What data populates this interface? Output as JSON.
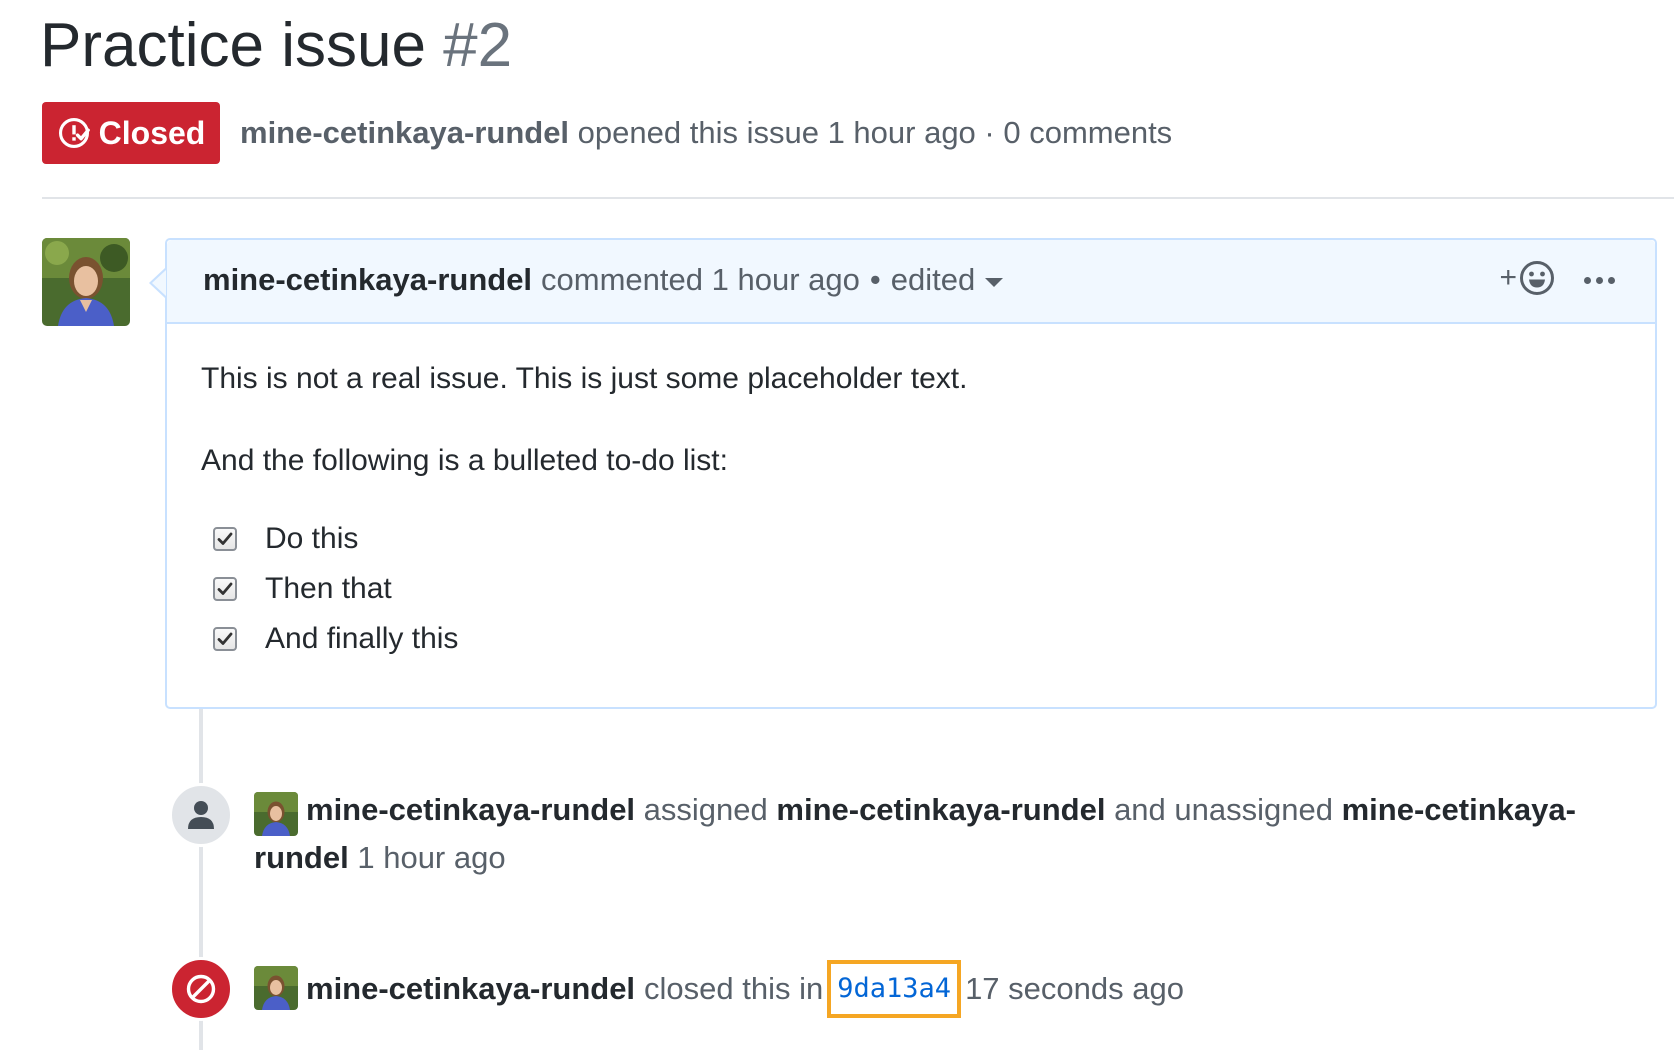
{
  "issue": {
    "title": "Practice issue",
    "number": "#2",
    "state": "Closed",
    "author": "mine-cetinkaya-rundel",
    "meta_rest": "opened this issue 1 hour ago · 0 comments",
    "state_color": "#cb2431"
  },
  "comment": {
    "author": "mine-cetinkaya-rundel",
    "action": "commented 1 hour ago",
    "edited": "edited",
    "separator": "•",
    "reaction_plus": "+",
    "body_paragraph_1": "This is not a real issue. This is just some placeholder text.",
    "body_paragraph_2": "And the following is a bulleted to-do list:",
    "tasks": [
      {
        "label": "Do this",
        "checked": true
      },
      {
        "label": "Then that",
        "checked": true
      },
      {
        "label": "And finally this",
        "checked": true
      }
    ]
  },
  "timeline": {
    "assign_event": {
      "actor": "mine-cetinkaya-rundel",
      "verb1": "assigned",
      "target1": "mine-cetinkaya-rundel",
      "verb2": "and unassigned",
      "target2": "mine-cetinkaya-rundel",
      "time": "1 hour ago"
    },
    "close_event": {
      "actor": "mine-cetinkaya-rundel",
      "verb": "closed this in",
      "commit": "9da13a4",
      "time": "17 seconds ago"
    }
  },
  "icons": {
    "state": "issue-closed-icon",
    "reaction": "smiley-icon",
    "menu": "kebab-horizontal-icon",
    "assign_badge": "person-icon",
    "close_badge": "circle-slash-icon"
  },
  "colors": {
    "link": "#0366d6",
    "highlight": "#f5a623",
    "comment_header_bg": "#f1f8ff",
    "comment_border": "#c8e1ff"
  }
}
